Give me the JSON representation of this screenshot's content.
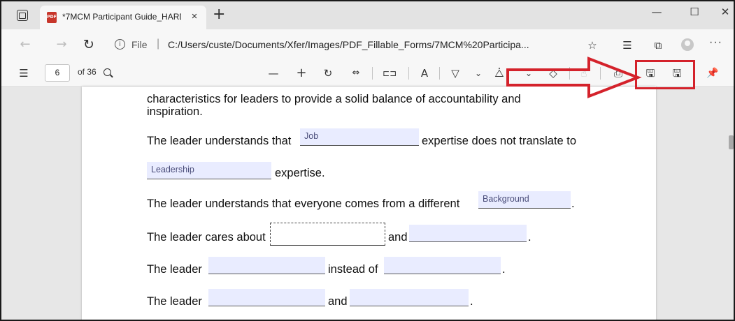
{
  "browser": {
    "tab_title": "*7MCM Participant Guide_HARD",
    "tab_close": "×",
    "new_tab": "+",
    "pdf_badge": "PDF",
    "window_min": "—",
    "window_max": "☐",
    "window_close": "✕"
  },
  "address": {
    "back": "←",
    "forward": "→",
    "refresh": "↻",
    "info": "i",
    "scheme": "File",
    "separator": "|",
    "url": "C:/Users/custe/Documents/Xfer/Images/PDF_Fillable_Forms/7MCM%20Participa...",
    "more": "···"
  },
  "pdf_toolbar": {
    "page_number": "6",
    "page_total": "of 36",
    "zoom_out": "—",
    "zoom_in": "+",
    "rotate": "↻",
    "fit": "⇔",
    "page_view": "⊏⊐",
    "read_aloud": "A",
    "draw": "▽",
    "draw_chevron": "⌄",
    "highlight": "⧊",
    "highlight_chevron": "⌄",
    "erase": "◇",
    "touch": "☝",
    "print": "⎙",
    "save": "🖫",
    "save_as": "🖫",
    "pin": "📌"
  },
  "document": {
    "line1": "characteristics for leaders to provide a solid balance of accountability and",
    "line2": "inspiration.",
    "s1_before": "The leader understands that",
    "s1_after": "expertise does not translate to",
    "s1_field": "Job",
    "s2_field": "Leadership",
    "s2_after": "expertise.",
    "s3_before": "The leader understands that everyone comes from a different",
    "s3_field": "Background",
    "s3_after": ".",
    "s4_before": "The leader cares about",
    "s4_mid": "and",
    "s4_after": ".",
    "s5_before": "The leader",
    "s5_mid": "instead of",
    "s5_after": ".",
    "s6_before": "The leader",
    "s6_mid": "and",
    "s6_after": "."
  },
  "annotation_color": "#d4222b"
}
